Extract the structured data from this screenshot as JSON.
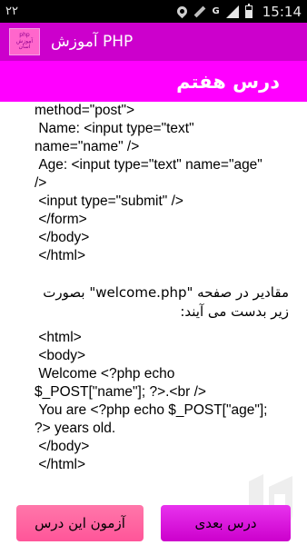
{
  "status_bar": {
    "left_text": "۲۲",
    "time": "15:14",
    "network": "G",
    "icons": [
      "location-icon",
      "satellite-icon",
      "signal-icon",
      "battery-icon"
    ]
  },
  "app_bar": {
    "title": "آموزش PHP",
    "logo_lines": [
      "php",
      "آموزش",
      "آسان"
    ]
  },
  "lesson": {
    "title": "درس هفتم"
  },
  "content": {
    "code_block_1": [
      "method=\"post\">",
      " Name: <input type=\"text\"",
      "name=\"name\" />",
      " Age: <input type=\"text\" name=\"age\"",
      "/>",
      " <input type=\"submit\" />",
      " </form>",
      " </body>",
      " </html>"
    ],
    "paragraph": "مقادیر در صفحه \"welcome.php\" بصورت زیر بدست می آیند:",
    "code_block_2": [
      " <html>",
      " <body>",
      " Welcome <?php echo",
      "$_POST[\"name\"]; ?>.<br />",
      " You are <?php echo $_POST[\"age\"];",
      "?> years old.",
      " </body>",
      " </html>"
    ]
  },
  "buttons": {
    "quiz_label": "آزمون این درس",
    "next_label": "درس بعدی"
  },
  "colors": {
    "header": "#cc00cc",
    "banner": "#ff00ff",
    "quiz_button": "#ff66aa",
    "next_button": "#dd22dd"
  }
}
